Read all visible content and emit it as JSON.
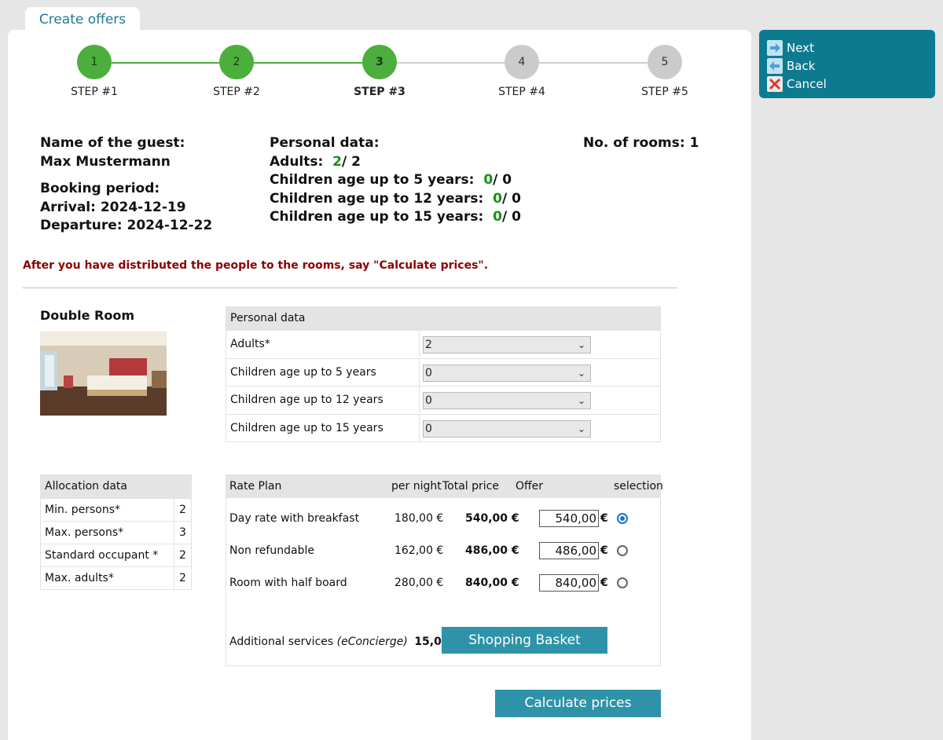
{
  "tab": {
    "label": "Create offers"
  },
  "steps": [
    {
      "number": "1",
      "label": "STEP #1",
      "state": "done"
    },
    {
      "number": "2",
      "label": "STEP #2",
      "state": "done"
    },
    {
      "number": "3",
      "label": "STEP #3",
      "state": "current"
    },
    {
      "number": "4",
      "label": "STEP #4",
      "state": "todo"
    },
    {
      "number": "5",
      "label": "STEP #5",
      "state": "todo"
    }
  ],
  "guest": {
    "name_label": "Name of the guest:",
    "name": "Max Mustermann",
    "booking_label": "Booking period:",
    "arrival": "Arrival: 2024-12-19",
    "departure": "Departure: 2024-12-22"
  },
  "personal": {
    "title": "Personal data:",
    "adults_label": "Adults:",
    "adults_value": "2",
    "adults_total": "/ 2",
    "c5_label": "Children age up to 5 years:",
    "c5_value": "0",
    "c5_total": "/ 0",
    "c12_label": "Children age up to 12 years:",
    "c12_value": "0",
    "c12_total": "/ 0",
    "c15_label": "Children age up to 15 years:",
    "c15_value": "0",
    "c15_total": "/ 0"
  },
  "rooms_count": "No. of rooms: 1",
  "notice": "After you have distributed the people to the rooms, say \"Calculate prices\".",
  "room": {
    "title": "Double Room",
    "personal_table": {
      "header": "Personal data",
      "rows": [
        {
          "label": "Adults*",
          "value": "2"
        },
        {
          "label": "Children age up to 5 years",
          "value": "0"
        },
        {
          "label": "Children age up to 12 years",
          "value": "0"
        },
        {
          "label": "Children age up to 15 years",
          "value": "0"
        }
      ]
    },
    "allocation": {
      "header": "Allocation data",
      "rows": [
        {
          "label": "Min. persons*",
          "value": "2"
        },
        {
          "label": "Max. persons*",
          "value": "3"
        },
        {
          "label": "Standard occupant *",
          "value": "2"
        },
        {
          "label": "Max. adults*",
          "value": "2"
        }
      ]
    },
    "rates": {
      "headers": {
        "plan": "Rate Plan",
        "per_night": "per night",
        "total": "Total price",
        "offer": "Offer",
        "selection": "selection"
      },
      "rows": [
        {
          "name": "Day rate with breakfast",
          "per_night": "180,00 €",
          "total": "540,00 €",
          "offer": "540,00",
          "currency": "€",
          "selected": true
        },
        {
          "name": "Non refundable",
          "per_night": "162,00 €",
          "total": "486,00 €",
          "offer": "486,00",
          "currency": "€",
          "selected": false
        },
        {
          "name": "Room with half board",
          "per_night": "280,00 €",
          "total": "840,00 €",
          "offer": "840,00",
          "currency": "€",
          "selected": false
        }
      ],
      "additional_label": "Additional services",
      "additional_note": "(eConcierge)",
      "additional_amount": "15,00 €",
      "basket_label": "Shopping Basket"
    }
  },
  "calculate_label": "Calculate prices",
  "actions": {
    "next": "Next",
    "back": "Back",
    "cancel": "Cancel"
  },
  "colors": {
    "accent": "#2e93a8",
    "actions_bg": "#0e7a90",
    "step_done": "#4cae3c",
    "notice": "#8b0000"
  }
}
